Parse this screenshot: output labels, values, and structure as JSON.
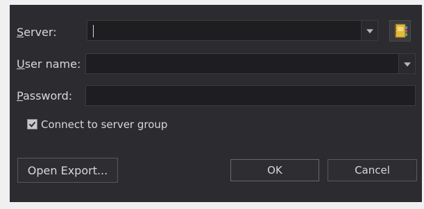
{
  "dialog": {
    "server": {
      "label_mnemonic": "S",
      "label_rest": "erver:",
      "value": ""
    },
    "username": {
      "label_mnemonic": "U",
      "label_rest": "ser name:",
      "value": ""
    },
    "password": {
      "label_mnemonic": "P",
      "label_rest": "assword:",
      "value": ""
    },
    "connect_group": {
      "label": "Connect to server group",
      "checked": true
    },
    "buttons": {
      "open_export": "Open Export...",
      "ok": "OK",
      "cancel": "Cancel"
    },
    "icons": {
      "server_dropdown": "chevron-down-icon",
      "username_dropdown": "chevron-down-icon",
      "address_book": "address-book-icon",
      "checkbox": "checkmark-icon"
    },
    "colors": {
      "background": "#2c2c30",
      "field": "#1e1e21",
      "text": "#d8d8d8"
    }
  }
}
